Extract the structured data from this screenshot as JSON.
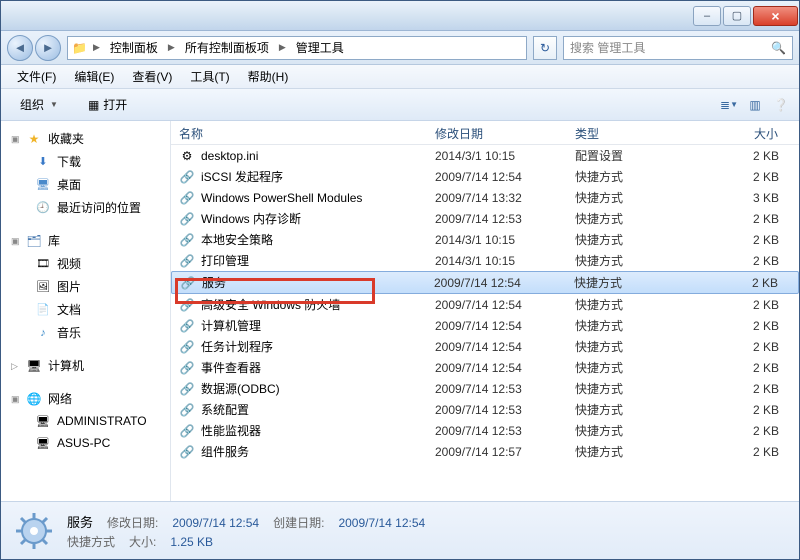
{
  "titlebar": {
    "min": "–",
    "max": "▢",
    "close": "×"
  },
  "breadcrumbs": [
    "控制面板",
    "所有控制面板项",
    "管理工具"
  ],
  "search": {
    "placeholder": "搜索 管理工具"
  },
  "menu": [
    "文件(F)",
    "编辑(E)",
    "查看(V)",
    "工具(T)",
    "帮助(H)"
  ],
  "toolbar": {
    "organize": "组织",
    "open": "打开"
  },
  "sidebar": {
    "favorites": {
      "label": "收藏夹",
      "items": [
        "下载",
        "桌面",
        "最近访问的位置"
      ]
    },
    "libraries": {
      "label": "库",
      "items": [
        "视频",
        "图片",
        "文档",
        "音乐"
      ]
    },
    "computer": {
      "label": "计算机"
    },
    "network": {
      "label": "网络",
      "items": [
        "ADMINISTRATO",
        "ASUS-PC"
      ]
    }
  },
  "columns": {
    "name": "名称",
    "date": "修改日期",
    "type": "类型",
    "size": "大小"
  },
  "files": [
    {
      "name": "desktop.ini",
      "date": "2014/3/1 10:15",
      "type": "配置设置",
      "size": "2 KB",
      "icon": "ini"
    },
    {
      "name": "iSCSI 发起程序",
      "date": "2009/7/14 12:54",
      "type": "快捷方式",
      "size": "2 KB",
      "icon": "link"
    },
    {
      "name": "Windows PowerShell Modules",
      "date": "2009/7/14 13:32",
      "type": "快捷方式",
      "size": "3 KB",
      "icon": "link"
    },
    {
      "name": "Windows 内存诊断",
      "date": "2009/7/14 12:53",
      "type": "快捷方式",
      "size": "2 KB",
      "icon": "link"
    },
    {
      "name": "本地安全策略",
      "date": "2014/3/1 10:15",
      "type": "快捷方式",
      "size": "2 KB",
      "icon": "link"
    },
    {
      "name": "打印管理",
      "date": "2014/3/1 10:15",
      "type": "快捷方式",
      "size": "2 KB",
      "icon": "link"
    },
    {
      "name": "服务",
      "date": "2009/7/14 12:54",
      "type": "快捷方式",
      "size": "2 KB",
      "icon": "link",
      "selected": true
    },
    {
      "name": "高级安全 Windows 防火墙",
      "date": "2009/7/14 12:54",
      "type": "快捷方式",
      "size": "2 KB",
      "icon": "link"
    },
    {
      "name": "计算机管理",
      "date": "2009/7/14 12:54",
      "type": "快捷方式",
      "size": "2 KB",
      "icon": "link"
    },
    {
      "name": "任务计划程序",
      "date": "2009/7/14 12:54",
      "type": "快捷方式",
      "size": "2 KB",
      "icon": "link"
    },
    {
      "name": "事件查看器",
      "date": "2009/7/14 12:54",
      "type": "快捷方式",
      "size": "2 KB",
      "icon": "link"
    },
    {
      "name": "数据源(ODBC)",
      "date": "2009/7/14 12:53",
      "type": "快捷方式",
      "size": "2 KB",
      "icon": "link"
    },
    {
      "name": "系统配置",
      "date": "2009/7/14 12:53",
      "type": "快捷方式",
      "size": "2 KB",
      "icon": "link"
    },
    {
      "name": "性能监视器",
      "date": "2009/7/14 12:53",
      "type": "快捷方式",
      "size": "2 KB",
      "icon": "link"
    },
    {
      "name": "组件服务",
      "date": "2009/7/14 12:57",
      "type": "快捷方式",
      "size": "2 KB",
      "icon": "link"
    }
  ],
  "details": {
    "name": "服务",
    "type": "快捷方式",
    "mod_lbl": "修改日期:",
    "mod_val": "2009/7/14 12:54",
    "create_lbl": "创建日期:",
    "create_val": "2009/7/14 12:54",
    "size_lbl": "大小:",
    "size_val": "1.25 KB"
  }
}
